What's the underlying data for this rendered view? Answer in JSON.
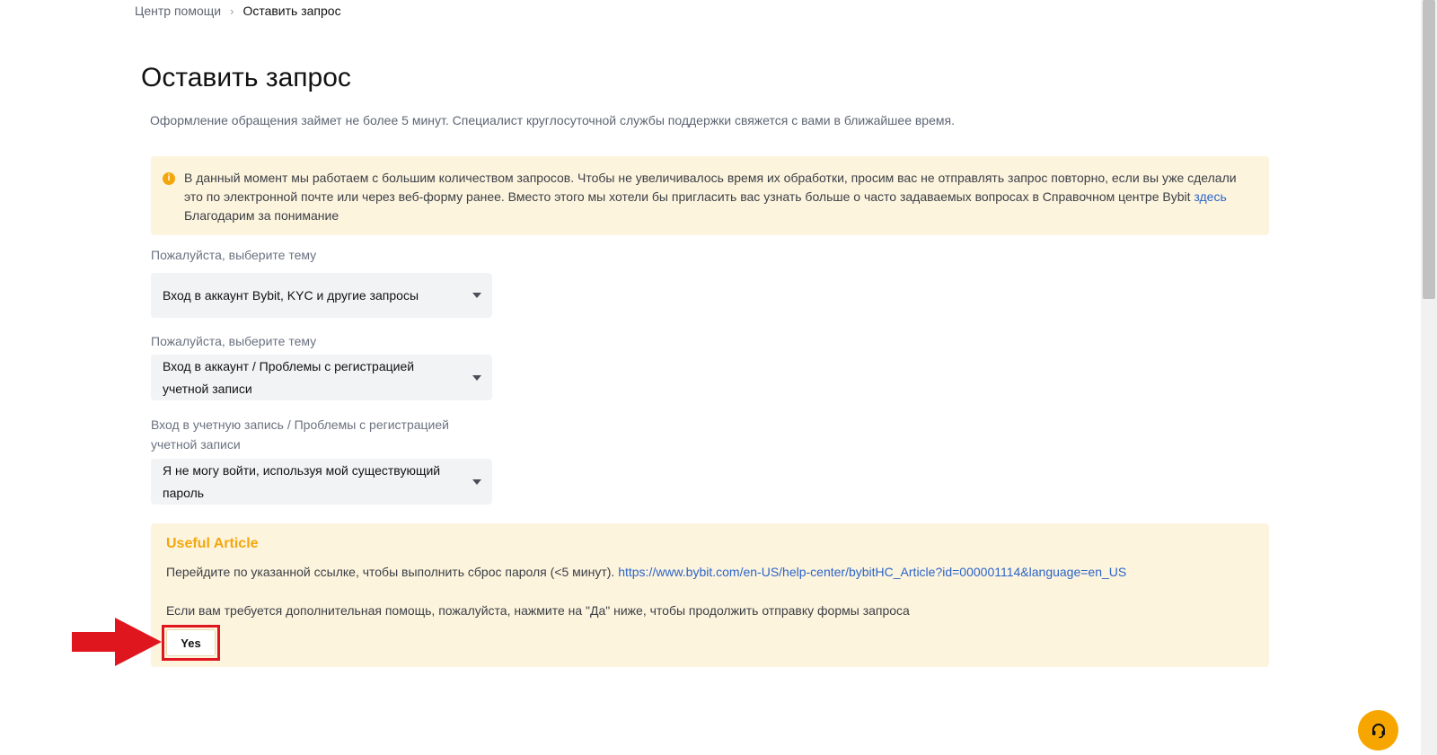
{
  "breadcrumb": {
    "home": "Центр помощи",
    "separator": "›",
    "current": "Оставить запрос"
  },
  "page": {
    "title": "Оставить запрос",
    "subtitle": "Оформление обращения займет не более 5 минут. Специалист круглосуточной службы поддержки свяжется с вами в ближайшее время."
  },
  "notice": {
    "icon": "info-icon",
    "text_before_link": "В данный момент мы работаем с большим количеством запросов. Чтобы не увеличивалось время их обработки, просим вас не отправлять запрос повторно, если вы уже сделали это по электронной почте или через веб-форму ранее. Вместо этого мы хотели бы пригласить вас узнать больше о часто задаваемых вопросах в Справочном центре Bybit ",
    "link": "здесь",
    "thanks": "Благодарим за понимание"
  },
  "form": {
    "topic1": {
      "label": "Пожалуйста, выберите тему",
      "value": "Вход в аккаунт Bybit, KYC и другие запросы"
    },
    "topic2": {
      "label": "Пожалуйста, выберите тему",
      "value_line1": "Вход в аккаунт / Проблемы с регистрацией",
      "value_line2": "учетной записи"
    },
    "topic3": {
      "label_line1": "Вход в учетную запись / Проблемы с регистрацией",
      "label_line2": "учетной записи",
      "value_line1": "Я не могу войти, используя мой существующий",
      "value_line2": "пароль"
    }
  },
  "article": {
    "title": "Useful Article",
    "text": "Перейдите по указанной ссылке, чтобы выполнить сброс пароля (<5 минут). ",
    "link": "https://www.bybit.com/en-US/help-center/bybitHC_Article?id=000001114&language=en_US",
    "help_text": "Если вам требуется дополнительная помощь, пожалуйста, нажмите на \"Да\" ниже, чтобы продолжить отправку формы запроса",
    "yes_label": "Yes"
  },
  "colors": {
    "accent": "#f7a600",
    "notice_bg": "#fdf4de",
    "link": "#2b65c8",
    "highlight": "#e0161e"
  },
  "icons": {
    "support": "headset-icon",
    "annotation": "red-arrow-icon"
  }
}
